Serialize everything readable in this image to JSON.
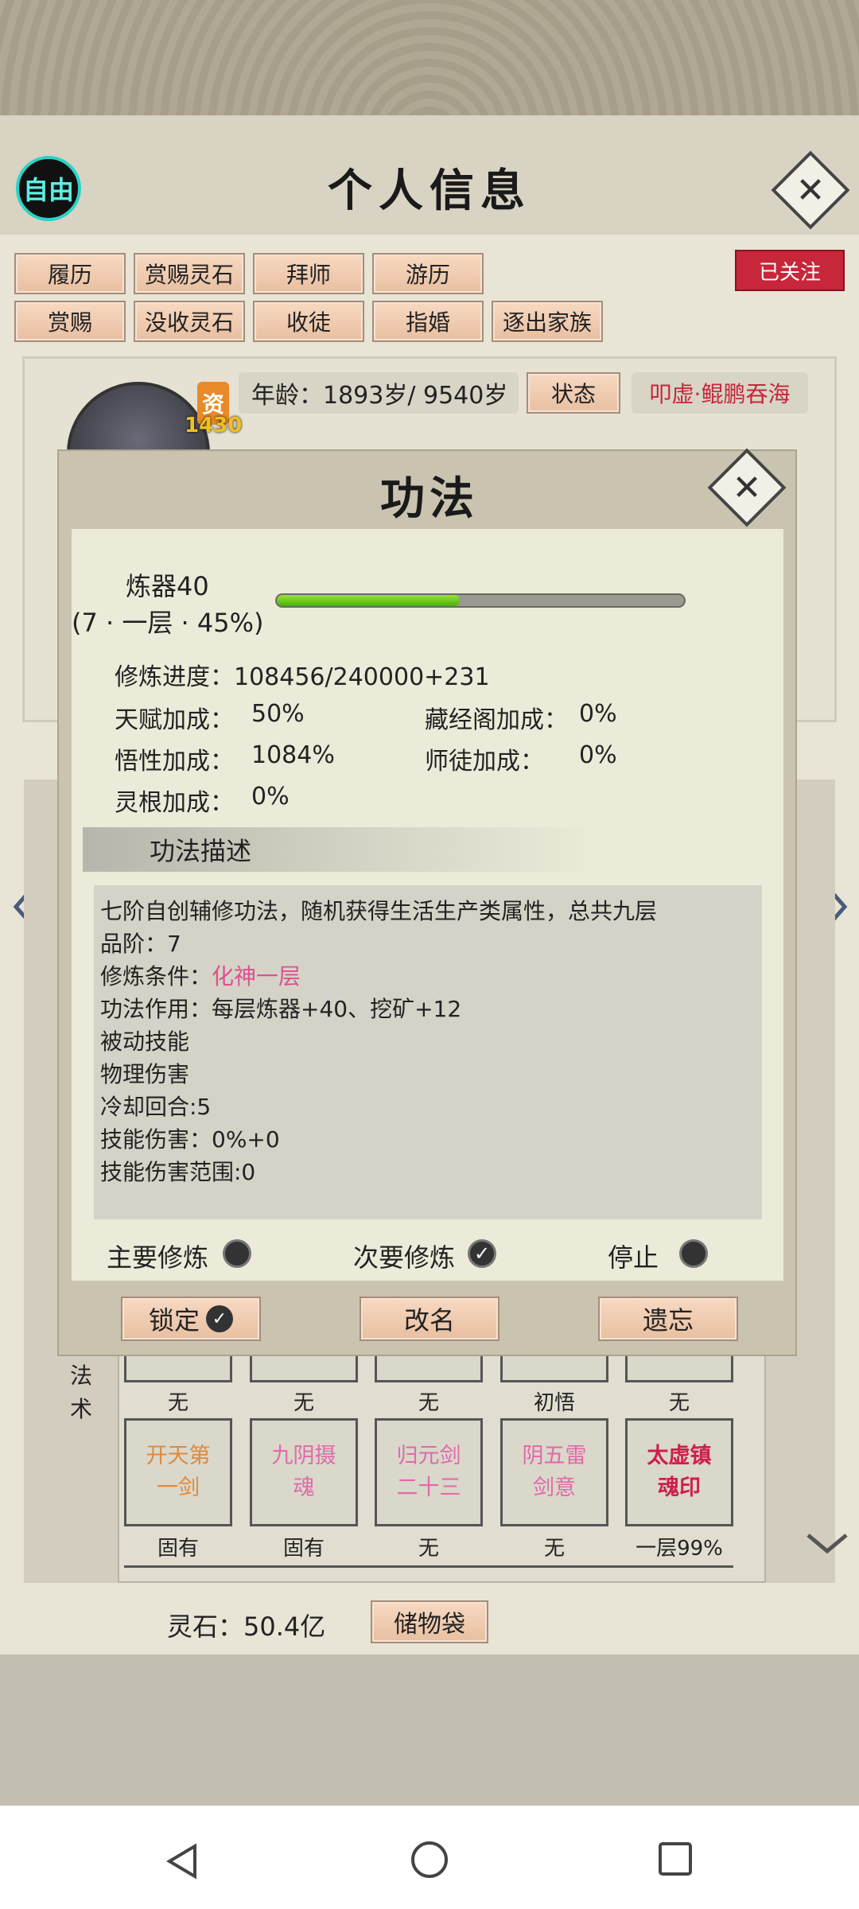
{
  "header": {
    "title": "个人信息",
    "free_badge": "自由"
  },
  "actions": {
    "row1": [
      "履历",
      "赏赐灵石",
      "拜师",
      "游历"
    ],
    "row2": [
      "赏赐",
      "没收灵石",
      "收徒",
      "指婚",
      "逐出家族"
    ],
    "followed": "已关注"
  },
  "profile": {
    "badge_char": "资",
    "badge_num": "1430",
    "age": "年龄：1893岁/ 9540岁",
    "status_button": "状态",
    "realm": "叩虚·鲲鹏吞海"
  },
  "modal": {
    "title": "功法",
    "skill_name": "炼器40",
    "skill_level": "(7 · 一层 · 45%)",
    "progress_fraction": 0.45,
    "progress": "修炼进度：108456/240000+231",
    "talent_label": "天赋加成：",
    "talent_value": "50%",
    "library_label": "藏经阁加成：",
    "library_value": "0%",
    "insight_label": "悟性加成：",
    "insight_value": "1084%",
    "master_label": "师徒加成：",
    "master_value": "0%",
    "root_label": "灵根加成：",
    "root_value": "0%",
    "desc_header": "功法描述",
    "desc_line1": "七阶自创辅修功法，随机获得生活生产类属性，总共九层",
    "desc_line2": "品阶：7",
    "desc_line3_label": "修炼条件：",
    "desc_line3_value": "化神一层",
    "desc_line4": "功法作用：每层炼器+40、挖矿+12",
    "desc_line5": "被动技能",
    "desc_line6": "物理伤害",
    "desc_line7": "冷却回合:5",
    "desc_line8": "技能伤害：0%+0",
    "desc_line9": "技能伤害范围:0",
    "main_cultivate": "主要修炼",
    "secondary_cultivate": "次要修炼",
    "stop": "停止",
    "lock_button": "锁定",
    "rename_button": "改名",
    "forget_button": "遗忘"
  },
  "skills": {
    "section_label_1": "法",
    "section_label_2": "术",
    "row1_labels": [
      "无",
      "无",
      "无",
      "初悟",
      "无"
    ],
    "row2_names": [
      "开天第\n一剑",
      "九阴摄\n魂",
      "归元剑\n二十三",
      "阴五雷\n剑意",
      "太虚镇\n魂印"
    ],
    "row2_colors": [
      "#e08a3a",
      "#e06aa8",
      "#e06aa8",
      "#e06aa8",
      "#d01e4a"
    ],
    "row2_labels": [
      "固有",
      "固有",
      "无",
      "无",
      "一层99%"
    ]
  },
  "footer": {
    "spirit_stones": "灵石：50.4亿",
    "bag_button": "储物袋"
  },
  "colors": {
    "accent_red": "#c8263a",
    "pink": "#e0508f",
    "progress_green": "#6dc61c"
  }
}
